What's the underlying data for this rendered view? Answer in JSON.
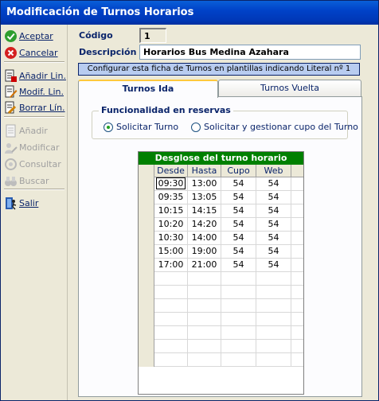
{
  "window": {
    "title": "Modificación de Turnos Horarios"
  },
  "toolbar": {
    "groups": [
      [
        {
          "label": "Aceptar",
          "icon": "check-icon",
          "enabled": true
        },
        {
          "label": "Cancelar",
          "icon": "cancel-icon",
          "enabled": true
        }
      ],
      [
        {
          "label": "Añadir Lin.",
          "icon": "add-line-icon",
          "enabled": true
        },
        {
          "label": "Modif. Lin.",
          "icon": "edit-line-icon",
          "enabled": true
        },
        {
          "label": "Borrar Lín.",
          "icon": "delete-line-icon",
          "enabled": true
        }
      ],
      [
        {
          "label": "Añadir",
          "icon": "add-icon",
          "enabled": false
        },
        {
          "label": "Modificar",
          "icon": "modify-icon",
          "enabled": false
        },
        {
          "label": "Consultar",
          "icon": "query-icon",
          "enabled": false
        },
        {
          "label": "Buscar",
          "icon": "binoculars-icon",
          "enabled": false
        }
      ],
      [
        {
          "label": "Salir",
          "icon": "exit-icon",
          "enabled": true
        }
      ]
    ]
  },
  "form": {
    "codigo_label": "Código",
    "codigo_value": "1",
    "descripcion_label": "Descripción",
    "descripcion_value": "Horarios Bus Medina Azahara",
    "info_text": "Configurar esta ficha de Turnos en plantillas indicando Literal nº 1"
  },
  "tabs": [
    {
      "label": "Turnos Ida",
      "active": true
    },
    {
      "label": "Turnos Vuelta",
      "active": false
    }
  ],
  "reservas": {
    "title": "Funcionalidad en reservas",
    "options": [
      {
        "label": "Solicitar Turno",
        "selected": true
      },
      {
        "label": "Solicitar y gestionar cupo del Turno",
        "selected": false
      }
    ]
  },
  "grid": {
    "title": "Desglose del turno horario",
    "columns": [
      "Desde",
      "Hasta",
      "Cupo",
      "Web"
    ],
    "rows": [
      [
        "09:30",
        "13:00",
        "54",
        "54"
      ],
      [
        "09:35",
        "13:05",
        "54",
        "54"
      ],
      [
        "10:15",
        "14:15",
        "54",
        "54"
      ],
      [
        "10:20",
        "14:20",
        "54",
        "54"
      ],
      [
        "10:30",
        "14:00",
        "54",
        "54"
      ],
      [
        "15:00",
        "19:00",
        "54",
        "54"
      ],
      [
        "17:00",
        "21:00",
        "54",
        "54"
      ]
    ],
    "empty_rows": 7
  },
  "colors": {
    "title_bar": "#0042c8",
    "grid_title_bg": "#008000",
    "info_bar_bg": "#b8ccf0",
    "label": "#0a246a"
  }
}
